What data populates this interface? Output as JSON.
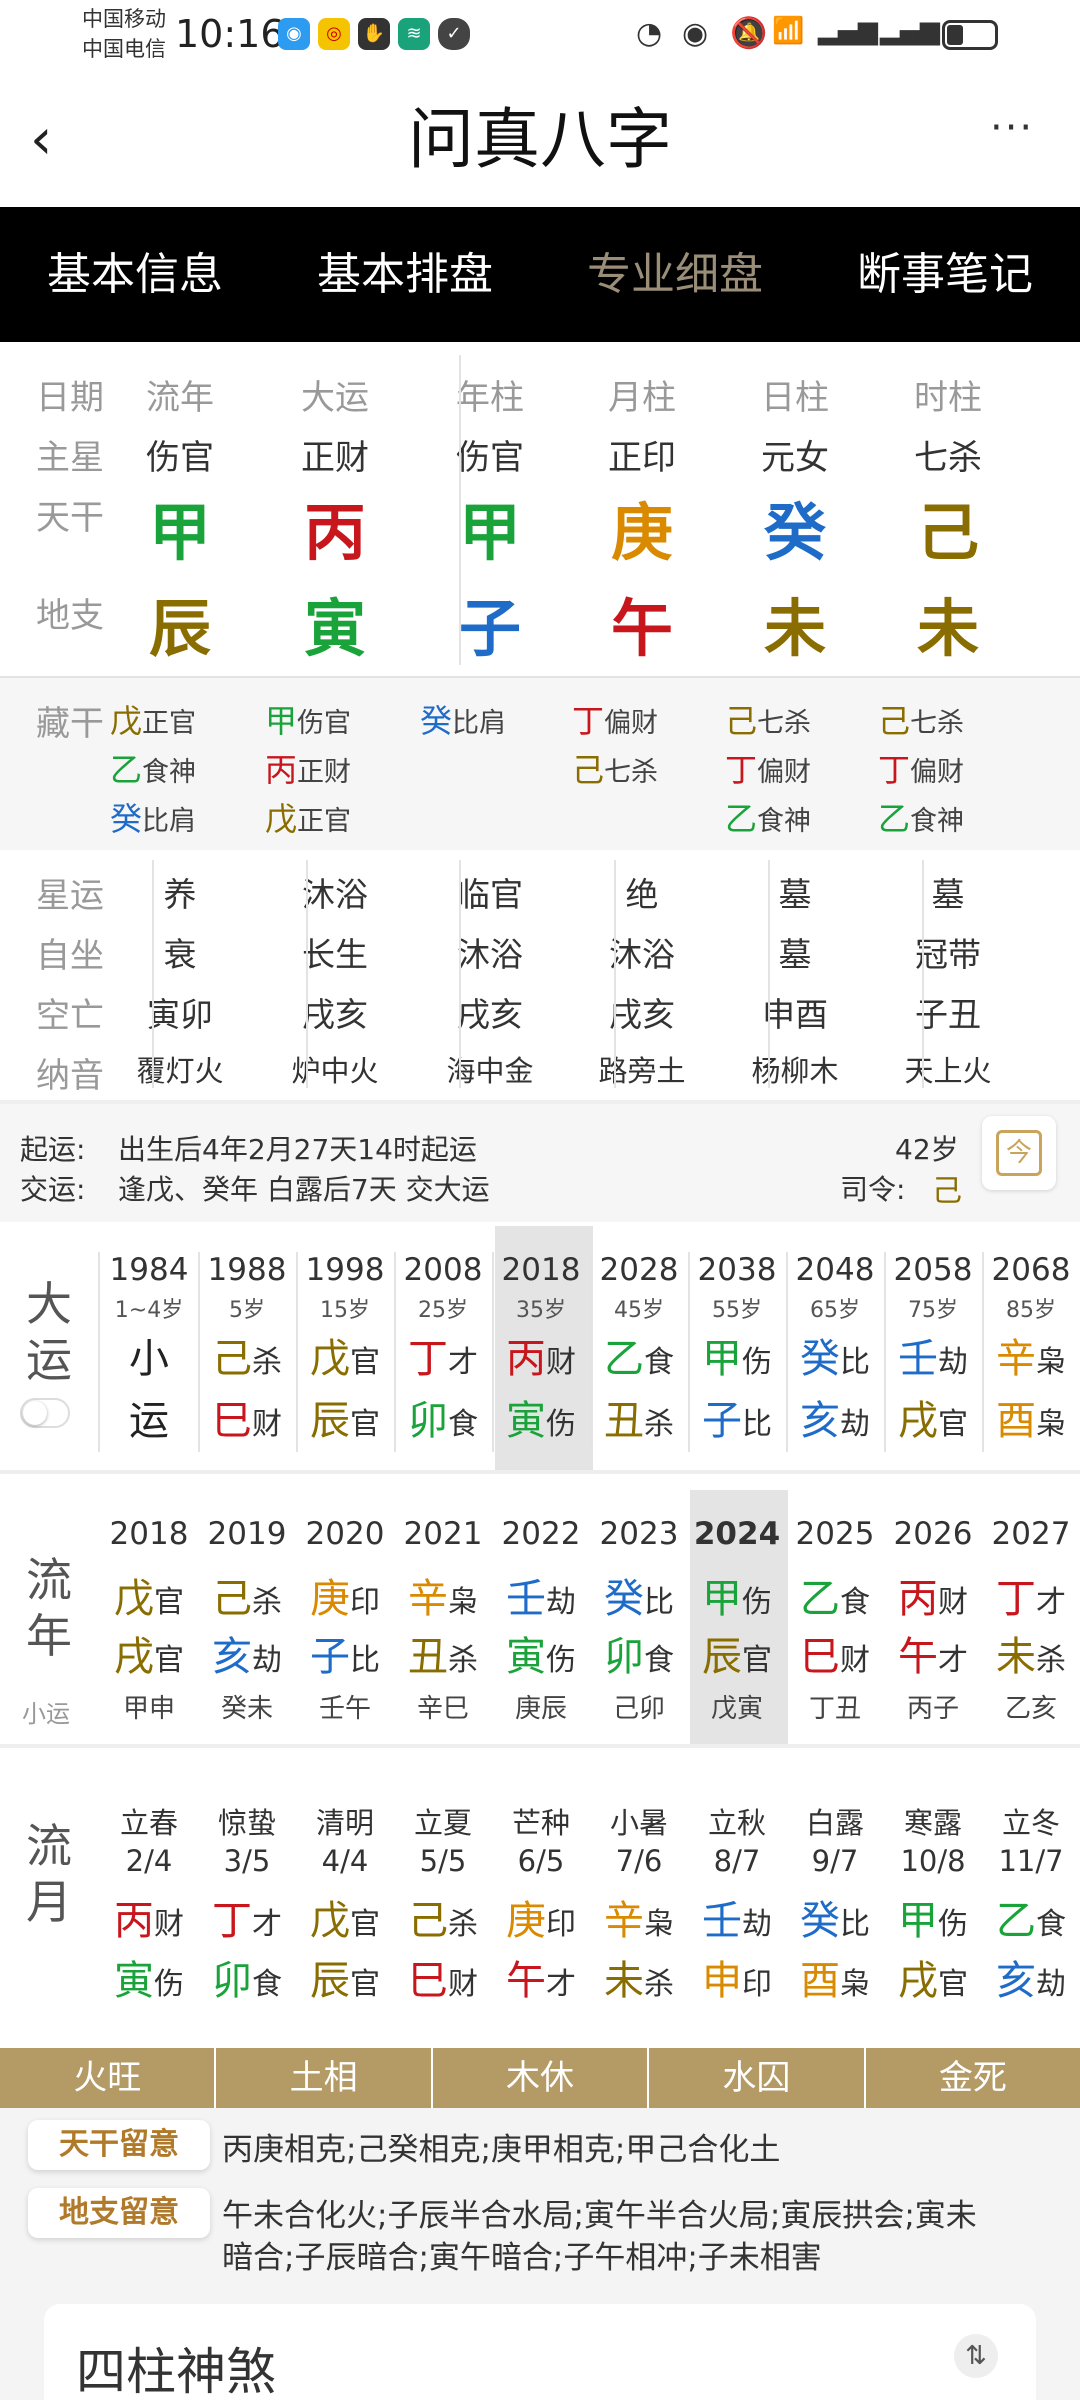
{
  "status": {
    "carrier1": "中国移动",
    "carrier2": "中国电信",
    "time": "10:16"
  },
  "header": {
    "title": "问真八字",
    "back_icon": "‹",
    "more_icon": "···"
  },
  "tabs": [
    "基本信息",
    "基本排盘",
    "专业细盘",
    "断事笔记"
  ],
  "row_labels": {
    "date": "日期",
    "star": "主星",
    "tiangan": "天干",
    "dizhi": "地支",
    "canggan": "藏干",
    "xingyun": "星运",
    "zizuo": "自坐",
    "kongwang": "空亡",
    "nayin": "纳音"
  },
  "pillars": [
    {
      "head": "流年",
      "star": "伤官",
      "gan": "甲",
      "ganc": "green",
      "zhi": "辰",
      "zhic": "olive",
      "cang": [
        [
          "戊",
          "正官",
          "olive"
        ],
        [
          "乙",
          "食神",
          "green"
        ],
        [
          "癸",
          "比肩",
          "blue"
        ]
      ],
      "xing": "养",
      "zizuo": "衰",
      "kong": "寅卯",
      "nayin": "覆灯火"
    },
    {
      "head": "大运",
      "star": "正财",
      "gan": "丙",
      "ganc": "red",
      "zhi": "寅",
      "zhic": "green",
      "cang": [
        [
          "甲",
          "伤官",
          "green"
        ],
        [
          "丙",
          "正财",
          "red"
        ],
        [
          "戊",
          "正官",
          "olive"
        ]
      ],
      "xing": "沐浴",
      "zizuo": "长生",
      "kong": "戌亥",
      "nayin": "炉中火"
    },
    {
      "head": "年柱",
      "star": "伤官",
      "gan": "甲",
      "ganc": "green",
      "zhi": "子",
      "zhic": "blue",
      "cang": [
        [
          "癸",
          "比肩",
          "blue"
        ]
      ],
      "xing": "临官",
      "zizuo": "沐浴",
      "kong": "戌亥",
      "nayin": "海中金"
    },
    {
      "head": "月柱",
      "star": "正印",
      "gan": "庚",
      "ganc": "orange",
      "zhi": "午",
      "zhic": "red",
      "cang": [
        [
          "丁",
          "偏财",
          "red"
        ],
        [
          "己",
          "七杀",
          "olive"
        ]
      ],
      "xing": "绝",
      "zizuo": "沐浴",
      "kong": "戌亥",
      "nayin": "路旁土"
    },
    {
      "head": "日柱",
      "star": "元女",
      "gan": "癸",
      "ganc": "blue",
      "zhi": "未",
      "zhic": "olive",
      "cang": [
        [
          "己",
          "七杀",
          "olive"
        ],
        [
          "丁",
          "偏财",
          "red"
        ],
        [
          "乙",
          "食神",
          "green"
        ]
      ],
      "xing": "墓",
      "zizuo": "墓",
      "kong": "申酉",
      "nayin": "杨柳木"
    },
    {
      "head": "时柱",
      "star": "七杀",
      "gan": "己",
      "ganc": "olive",
      "zhi": "未",
      "zhic": "olive",
      "cang": [
        [
          "己",
          "七杀",
          "olive"
        ],
        [
          "丁",
          "偏财",
          "red"
        ],
        [
          "乙",
          "食神",
          "green"
        ]
      ],
      "xing": "墓",
      "zizuo": "冠带",
      "kong": "子丑",
      "nayin": "天上火"
    }
  ],
  "qiyun": {
    "label1": "起运:",
    "text1": "出生后4年2月27天14时起运",
    "label2": "交运:",
    "text2": "逢戊、癸年 白露后7天 交大运",
    "age": "42岁",
    "siling_label": "司令:",
    "siling": "己",
    "today_icon": "今"
  },
  "dayun": {
    "title1": "大",
    "title2": "运",
    "items": [
      {
        "y": "1984",
        "a": "1~4岁",
        "g1": "小",
        "s1": "",
        "c1": "",
        "g2": "运",
        "s2": "",
        "c2": ""
      },
      {
        "y": "1988",
        "a": "5岁",
        "g1": "己",
        "s1": "杀",
        "c1": "olive",
        "g2": "巳",
        "s2": "财",
        "c2": "red"
      },
      {
        "y": "1998",
        "a": "15岁",
        "g1": "戊",
        "s1": "官",
        "c1": "olive",
        "g2": "辰",
        "s2": "官",
        "c2": "olive"
      },
      {
        "y": "2008",
        "a": "25岁",
        "g1": "丁",
        "s1": "才",
        "c1": "red",
        "g2": "卯",
        "s2": "食",
        "c2": "green"
      },
      {
        "y": "2018",
        "a": "35岁",
        "g1": "丙",
        "s1": "财",
        "c1": "red",
        "g2": "寅",
        "s2": "伤",
        "c2": "green"
      },
      {
        "y": "2028",
        "a": "45岁",
        "g1": "乙",
        "s1": "食",
        "c1": "green",
        "g2": "丑",
        "s2": "杀",
        "c2": "olive"
      },
      {
        "y": "2038",
        "a": "55岁",
        "g1": "甲",
        "s1": "伤",
        "c1": "green",
        "g2": "子",
        "s2": "比",
        "c2": "blue"
      },
      {
        "y": "2048",
        "a": "65岁",
        "g1": "癸",
        "s1": "比",
        "c1": "blue",
        "g2": "亥",
        "s2": "劫",
        "c2": "blue"
      },
      {
        "y": "2058",
        "a": "75岁",
        "g1": "壬",
        "s1": "劫",
        "c1": "blue",
        "g2": "戌",
        "s2": "官",
        "c2": "olive"
      },
      {
        "y": "2068",
        "a": "85岁",
        "g1": "辛",
        "s1": "枭",
        "c1": "orange",
        "g2": "酉",
        "s2": "枭",
        "c2": "orange"
      }
    ]
  },
  "liunian": {
    "title1": "流",
    "title2": "年",
    "sub": "小运",
    "items": [
      {
        "y": "2018",
        "g1": "戊",
        "s1": "官",
        "c1": "olive",
        "g2": "戌",
        "s2": "官",
        "c2": "olive",
        "x": "甲申"
      },
      {
        "y": "2019",
        "g1": "己",
        "s1": "杀",
        "c1": "olive",
        "g2": "亥",
        "s2": "劫",
        "c2": "blue",
        "x": "癸未"
      },
      {
        "y": "2020",
        "g1": "庚",
        "s1": "印",
        "c1": "orange",
        "g2": "子",
        "s2": "比",
        "c2": "blue",
        "x": "壬午"
      },
      {
        "y": "2021",
        "g1": "辛",
        "s1": "枭",
        "c1": "orange",
        "g2": "丑",
        "s2": "杀",
        "c2": "olive",
        "x": "辛巳"
      },
      {
        "y": "2022",
        "g1": "壬",
        "s1": "劫",
        "c1": "blue",
        "g2": "寅",
        "s2": "伤",
        "c2": "green",
        "x": "庚辰"
      },
      {
        "y": "2023",
        "g1": "癸",
        "s1": "比",
        "c1": "blue",
        "g2": "卯",
        "s2": "食",
        "c2": "green",
        "x": "己卯"
      },
      {
        "y": "2024",
        "g1": "甲",
        "s1": "伤",
        "c1": "green",
        "g2": "辰",
        "s2": "官",
        "c2": "olive",
        "x": "戊寅"
      },
      {
        "y": "2025",
        "g1": "乙",
        "s1": "食",
        "c1": "green",
        "g2": "巳",
        "s2": "财",
        "c2": "red",
        "x": "丁丑"
      },
      {
        "y": "2026",
        "g1": "丙",
        "s1": "财",
        "c1": "red",
        "g2": "午",
        "s2": "才",
        "c2": "red",
        "x": "丙子"
      },
      {
        "y": "2027",
        "g1": "丁",
        "s1": "才",
        "c1": "red",
        "g2": "未",
        "s2": "杀",
        "c2": "olive",
        "x": "乙亥"
      }
    ]
  },
  "liuyue": {
    "title1": "流",
    "title2": "月",
    "items": [
      {
        "t": "立春",
        "d": "2/4",
        "g1": "丙",
        "s1": "财",
        "c1": "red",
        "g2": "寅",
        "s2": "伤",
        "c2": "green"
      },
      {
        "t": "惊蛰",
        "d": "3/5",
        "g1": "丁",
        "s1": "才",
        "c1": "red",
        "g2": "卯",
        "s2": "食",
        "c2": "green"
      },
      {
        "t": "清明",
        "d": "4/4",
        "g1": "戊",
        "s1": "官",
        "c1": "olive",
        "g2": "辰",
        "s2": "官",
        "c2": "olive"
      },
      {
        "t": "立夏",
        "d": "5/5",
        "g1": "己",
        "s1": "杀",
        "c1": "olive",
        "g2": "巳",
        "s2": "财",
        "c2": "red"
      },
      {
        "t": "芒种",
        "d": "6/5",
        "g1": "庚",
        "s1": "印",
        "c1": "orange",
        "g2": "午",
        "s2": "才",
        "c2": "red"
      },
      {
        "t": "小暑",
        "d": "7/6",
        "g1": "辛",
        "s1": "枭",
        "c1": "orange",
        "g2": "未",
        "s2": "杀",
        "c2": "olive"
      },
      {
        "t": "立秋",
        "d": "8/7",
        "g1": "壬",
        "s1": "劫",
        "c1": "blue",
        "g2": "申",
        "s2": "印",
        "c2": "orange"
      },
      {
        "t": "白露",
        "d": "9/7",
        "g1": "癸",
        "s1": "比",
        "c1": "blue",
        "g2": "酉",
        "s2": "枭",
        "c2": "orange"
      },
      {
        "t": "寒露",
        "d": "10/8",
        "g1": "甲",
        "s1": "伤",
        "c1": "green",
        "g2": "戌",
        "s2": "官",
        "c2": "olive"
      },
      {
        "t": "立冬",
        "d": "11/7",
        "g1": "乙",
        "s1": "食",
        "c1": "green",
        "g2": "亥",
        "s2": "劫",
        "c2": "blue"
      }
    ]
  },
  "wuxing": [
    "火旺",
    "土相",
    "木休",
    "水囚",
    "金死"
  ],
  "notes": {
    "tg_label": "天干留意",
    "tg_text": "丙庚相克;己癸相克;庚甲相克;甲己合化土",
    "dz_label": "地支留意",
    "dz_text1": "午未合化火;子辰半合水局;寅午半合火局;寅辰拱会;寅未",
    "dz_text2": "暗合;子辰暗合;寅午暗合;子午相冲;子未相害"
  },
  "shensha": {
    "title": "四柱神煞",
    "sort_icon": "⇅"
  }
}
